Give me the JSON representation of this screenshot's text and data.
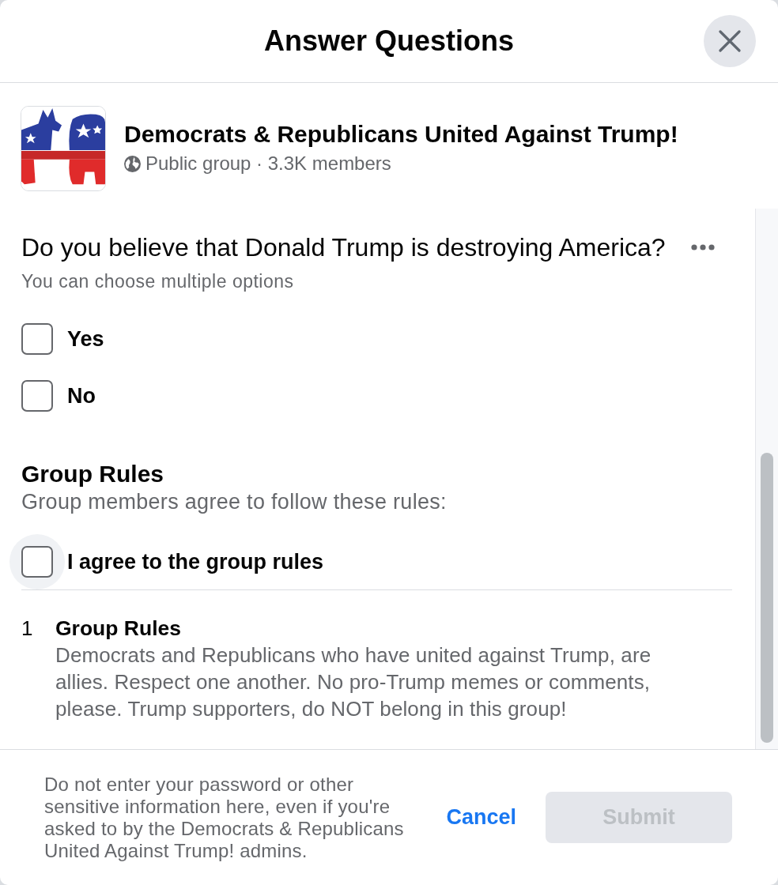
{
  "dialog": {
    "title": "Answer Questions"
  },
  "group": {
    "name": "Democrats & Republicans United Against Trump!",
    "meta": "Public group · 3.3K members"
  },
  "question": {
    "text": "Do you believe that Donald Trump is destroying America?",
    "hint": "You can choose multiple options",
    "options": [
      {
        "label": "Yes",
        "checked": false
      },
      {
        "label": "No",
        "checked": false
      }
    ]
  },
  "rules": {
    "title": "Group Rules",
    "subtitle": "Group members agree to follow these rules:",
    "agree": {
      "label": "I agree to the group rules",
      "checked": false,
      "focused": true
    },
    "items": [
      {
        "number": "1",
        "title": "Group Rules",
        "text": "Democrats and Republicans who have united against Trump, are allies. Respect one another. No pro-Trump memes or comments, please. Trump supporters, do NOT belong in this group!"
      }
    ]
  },
  "footer": {
    "notice": "Do not enter your password or other sensitive information here, even if you're asked to by the Democrats & Republicans United Against Trump! admins.",
    "cancel": "Cancel",
    "submit": {
      "label": "Submit",
      "disabled": true
    }
  }
}
